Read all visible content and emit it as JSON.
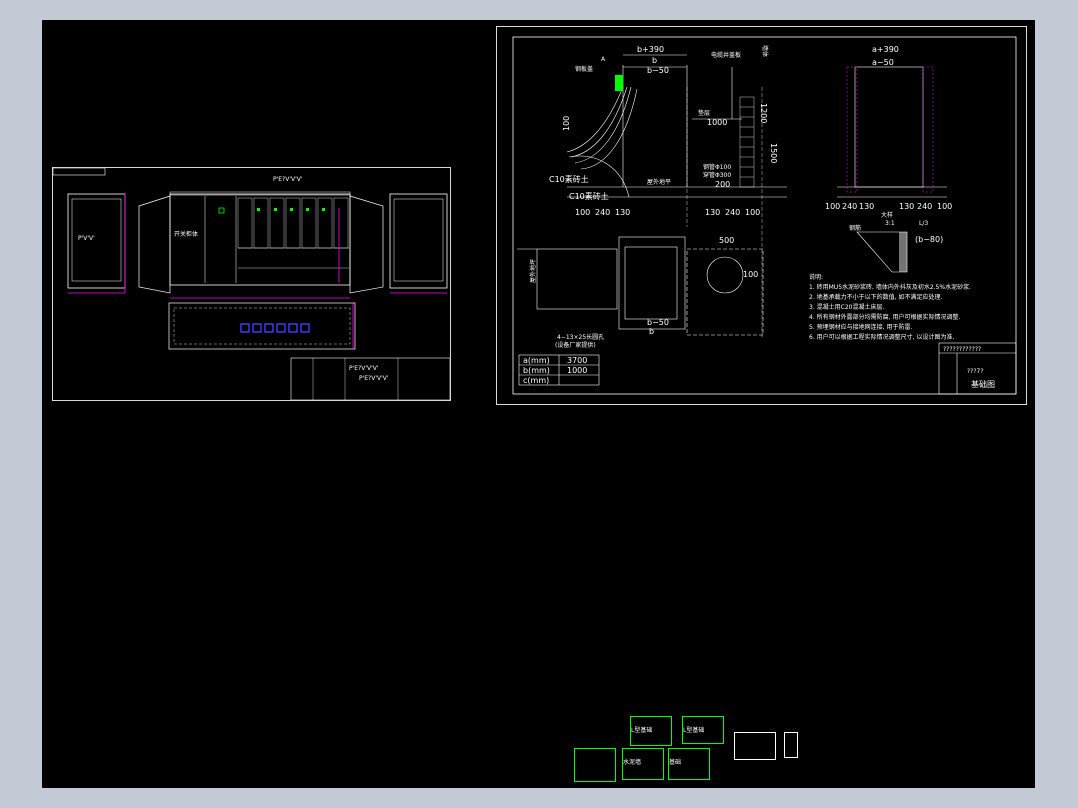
{
  "left_sheet": {
    "title": "P'E?V'V'V'",
    "panel_label": "开关柜体",
    "title_block": {
      "drawing_name": "P'E?V'V'V'",
      "name_line": "P'E?V'V'V'"
    }
  },
  "right_sheet": {
    "dims": {
      "b_total": "b+390",
      "b": "b",
      "b_minus": "b−50",
      "a_total": "a+390",
      "a_minus": "a−50",
      "d100a": "100",
      "d1000": "1000",
      "d1200": "1200",
      "d1500": "1500",
      "d240": "240",
      "d200": "200",
      "bottom_left": [
        "100",
        "240",
        "130"
      ],
      "bottom_mid": [
        "130",
        "240",
        "100"
      ],
      "bottom_right": [
        "100",
        "240",
        "130",
        "130",
        "240",
        "100"
      ],
      "d500": "500",
      "d100b": "100",
      "b_minus_plan": "b−50",
      "b_plan": "b",
      "c_label": "c",
      "ratio": "3:1",
      "ratio_label": "大样",
      "h_minus": "(b−80)",
      "l_mark": "L/3"
    },
    "labels": {
      "marker_a": "A",
      "steel_plate": "钢板盖",
      "cable_box": "电缆井盖板",
      "c10_a": "C10素砖土",
      "c10_b": "C10素砖土",
      "tag_a": "空心墙",
      "tag_b": "垫层",
      "wall": "墙体",
      "pipe": "钢管Φ100",
      "pipe2": "穿管Φ300",
      "level": "屋外地平",
      "cable_trench": "电缆沟",
      "bolts": "4−13×25长圆孔",
      "bolts_note": "(设备厂家提供)",
      "rebar": "钢筋",
      "side_label": "屋外地坪"
    },
    "spec_table": [
      {
        "key": "a(mm)",
        "value": "3700"
      },
      {
        "key": "b(mm)",
        "value": "1000"
      },
      {
        "key": "c(mm)",
        "value": ""
      }
    ],
    "notes_title": "说明:",
    "notes": [
      "1. 砖用MU5水泥砂浆砖, 墙体内外抖灰及初水2.5%水泥砂浆.",
      "2. 地基承载力不小于以下的数值, 如不满足应处理.",
      "3. 混凝土用C20混凝土床层.",
      "4. 所有钢材外露部分均需防腐, 用户可根据实际情况调整.",
      "5. 预埋钢材应与接地网连接, 用于防雷.",
      "6. 用户可以根据工程实际情况调整尺寸, 以设计图为准."
    ],
    "title_block": {
      "q_line": "????????????",
      "code": "???7?",
      "name": "基础图"
    }
  },
  "thumbnails": {
    "t1": "L型基础",
    "t2": "L型基础",
    "t3": "水泥墙",
    "t4": "基础"
  },
  "colors": {
    "background": "#000000",
    "frame": "#c3cad6",
    "magenta": "#ff00ff",
    "blue": "#4040ff",
    "green": "#00ff00",
    "white": "#ffffff"
  }
}
